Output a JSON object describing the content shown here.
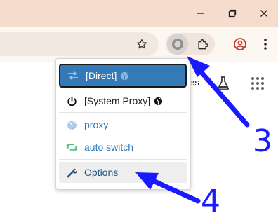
{
  "window": {
    "minimize_icon": "minimize-icon",
    "restore_icon": "restore-icon",
    "close_icon": "close-icon"
  },
  "toolbar": {
    "bookmark_icon": "star-icon",
    "proxy_extension_icon": "proxy-switch-icon",
    "extensions_icon": "puzzle-icon",
    "profile_icon": "profile-icon",
    "menu_icon": "kebab-menu-icon"
  },
  "page": {
    "partial_text": "es"
  },
  "popup": {
    "items": [
      {
        "label": "[Direct]",
        "icon": "transfer-arrows-icon",
        "state": "selected"
      },
      {
        "label": "[System Proxy]",
        "icon": "power-icon"
      },
      {
        "label": "proxy",
        "icon": "globe-icon"
      },
      {
        "label": "auto switch",
        "icon": "retweet-icon"
      },
      {
        "label": "Options",
        "icon": "wrench-icon"
      }
    ]
  },
  "annotations": {
    "step_3": "3",
    "step_4": "4",
    "arrow_color": "#1a1aff"
  },
  "colors": {
    "titlebar": "#f6dccd",
    "toolbar": "#fdf7f2",
    "menu_selected": "#337ab7",
    "menu_link": "#337ab7",
    "auto_switch_icon": "#55c28a"
  }
}
